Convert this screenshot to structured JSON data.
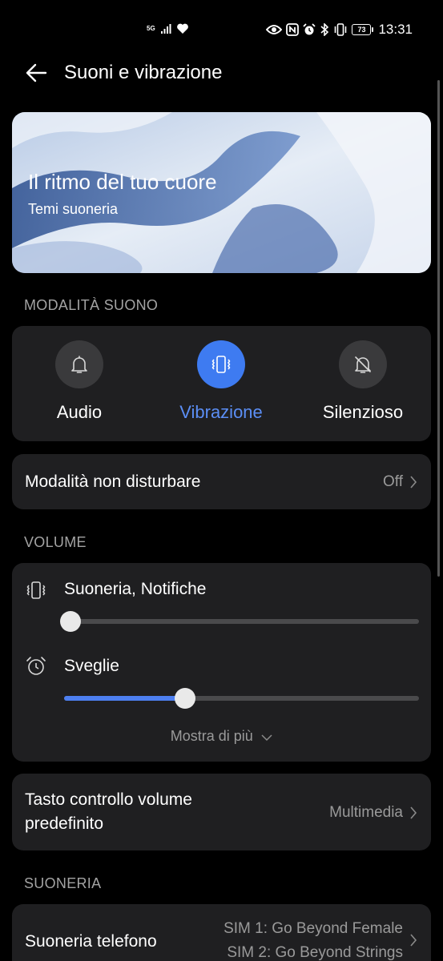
{
  "status_bar": {
    "network": "5G",
    "time": "13:31",
    "battery_level": "73",
    "icons": [
      "signal-icon",
      "heart-icon",
      "eye-icon",
      "nfc-icon",
      "alarm-icon",
      "bluetooth-icon",
      "vibrate-icon",
      "battery-icon"
    ]
  },
  "header": {
    "title": "Suoni e vibrazione"
  },
  "banner": {
    "title": "Il ritmo del tuo cuore",
    "subtitle": "Temi suoneria"
  },
  "sound_mode": {
    "section_label": "MODALITÀ SUONO",
    "modes": [
      {
        "label": "Audio",
        "icon": "bell-icon",
        "active": false
      },
      {
        "label": "Vibrazione",
        "icon": "vibrate-icon",
        "active": true
      },
      {
        "label": "Silenzioso",
        "icon": "bell-off-icon",
        "active": false
      }
    ]
  },
  "dnd": {
    "label": "Modalità non disturbare",
    "value": "Off"
  },
  "volume": {
    "section_label": "VOLUME",
    "sliders": [
      {
        "label": "Suoneria, Notifiche",
        "icon": "vibrate-icon",
        "level": 0.0
      },
      {
        "label": "Sveglie",
        "icon": "alarm-clock-icon",
        "level": 0.34
      }
    ],
    "show_more": "Mostra di più"
  },
  "volume_key": {
    "label_line1": "Tasto controllo volume",
    "label_line2": "predefinito",
    "value": "Multimedia"
  },
  "ringtone": {
    "section_label": "SUONERIA",
    "label": "Suoneria telefono",
    "sim1": "SIM 1: Go Beyond Female",
    "sim2": "SIM 2: Go Beyond Strings"
  },
  "colors": {
    "accent": "#3e7bf1",
    "card": "#1f1f21",
    "background": "#000000"
  }
}
